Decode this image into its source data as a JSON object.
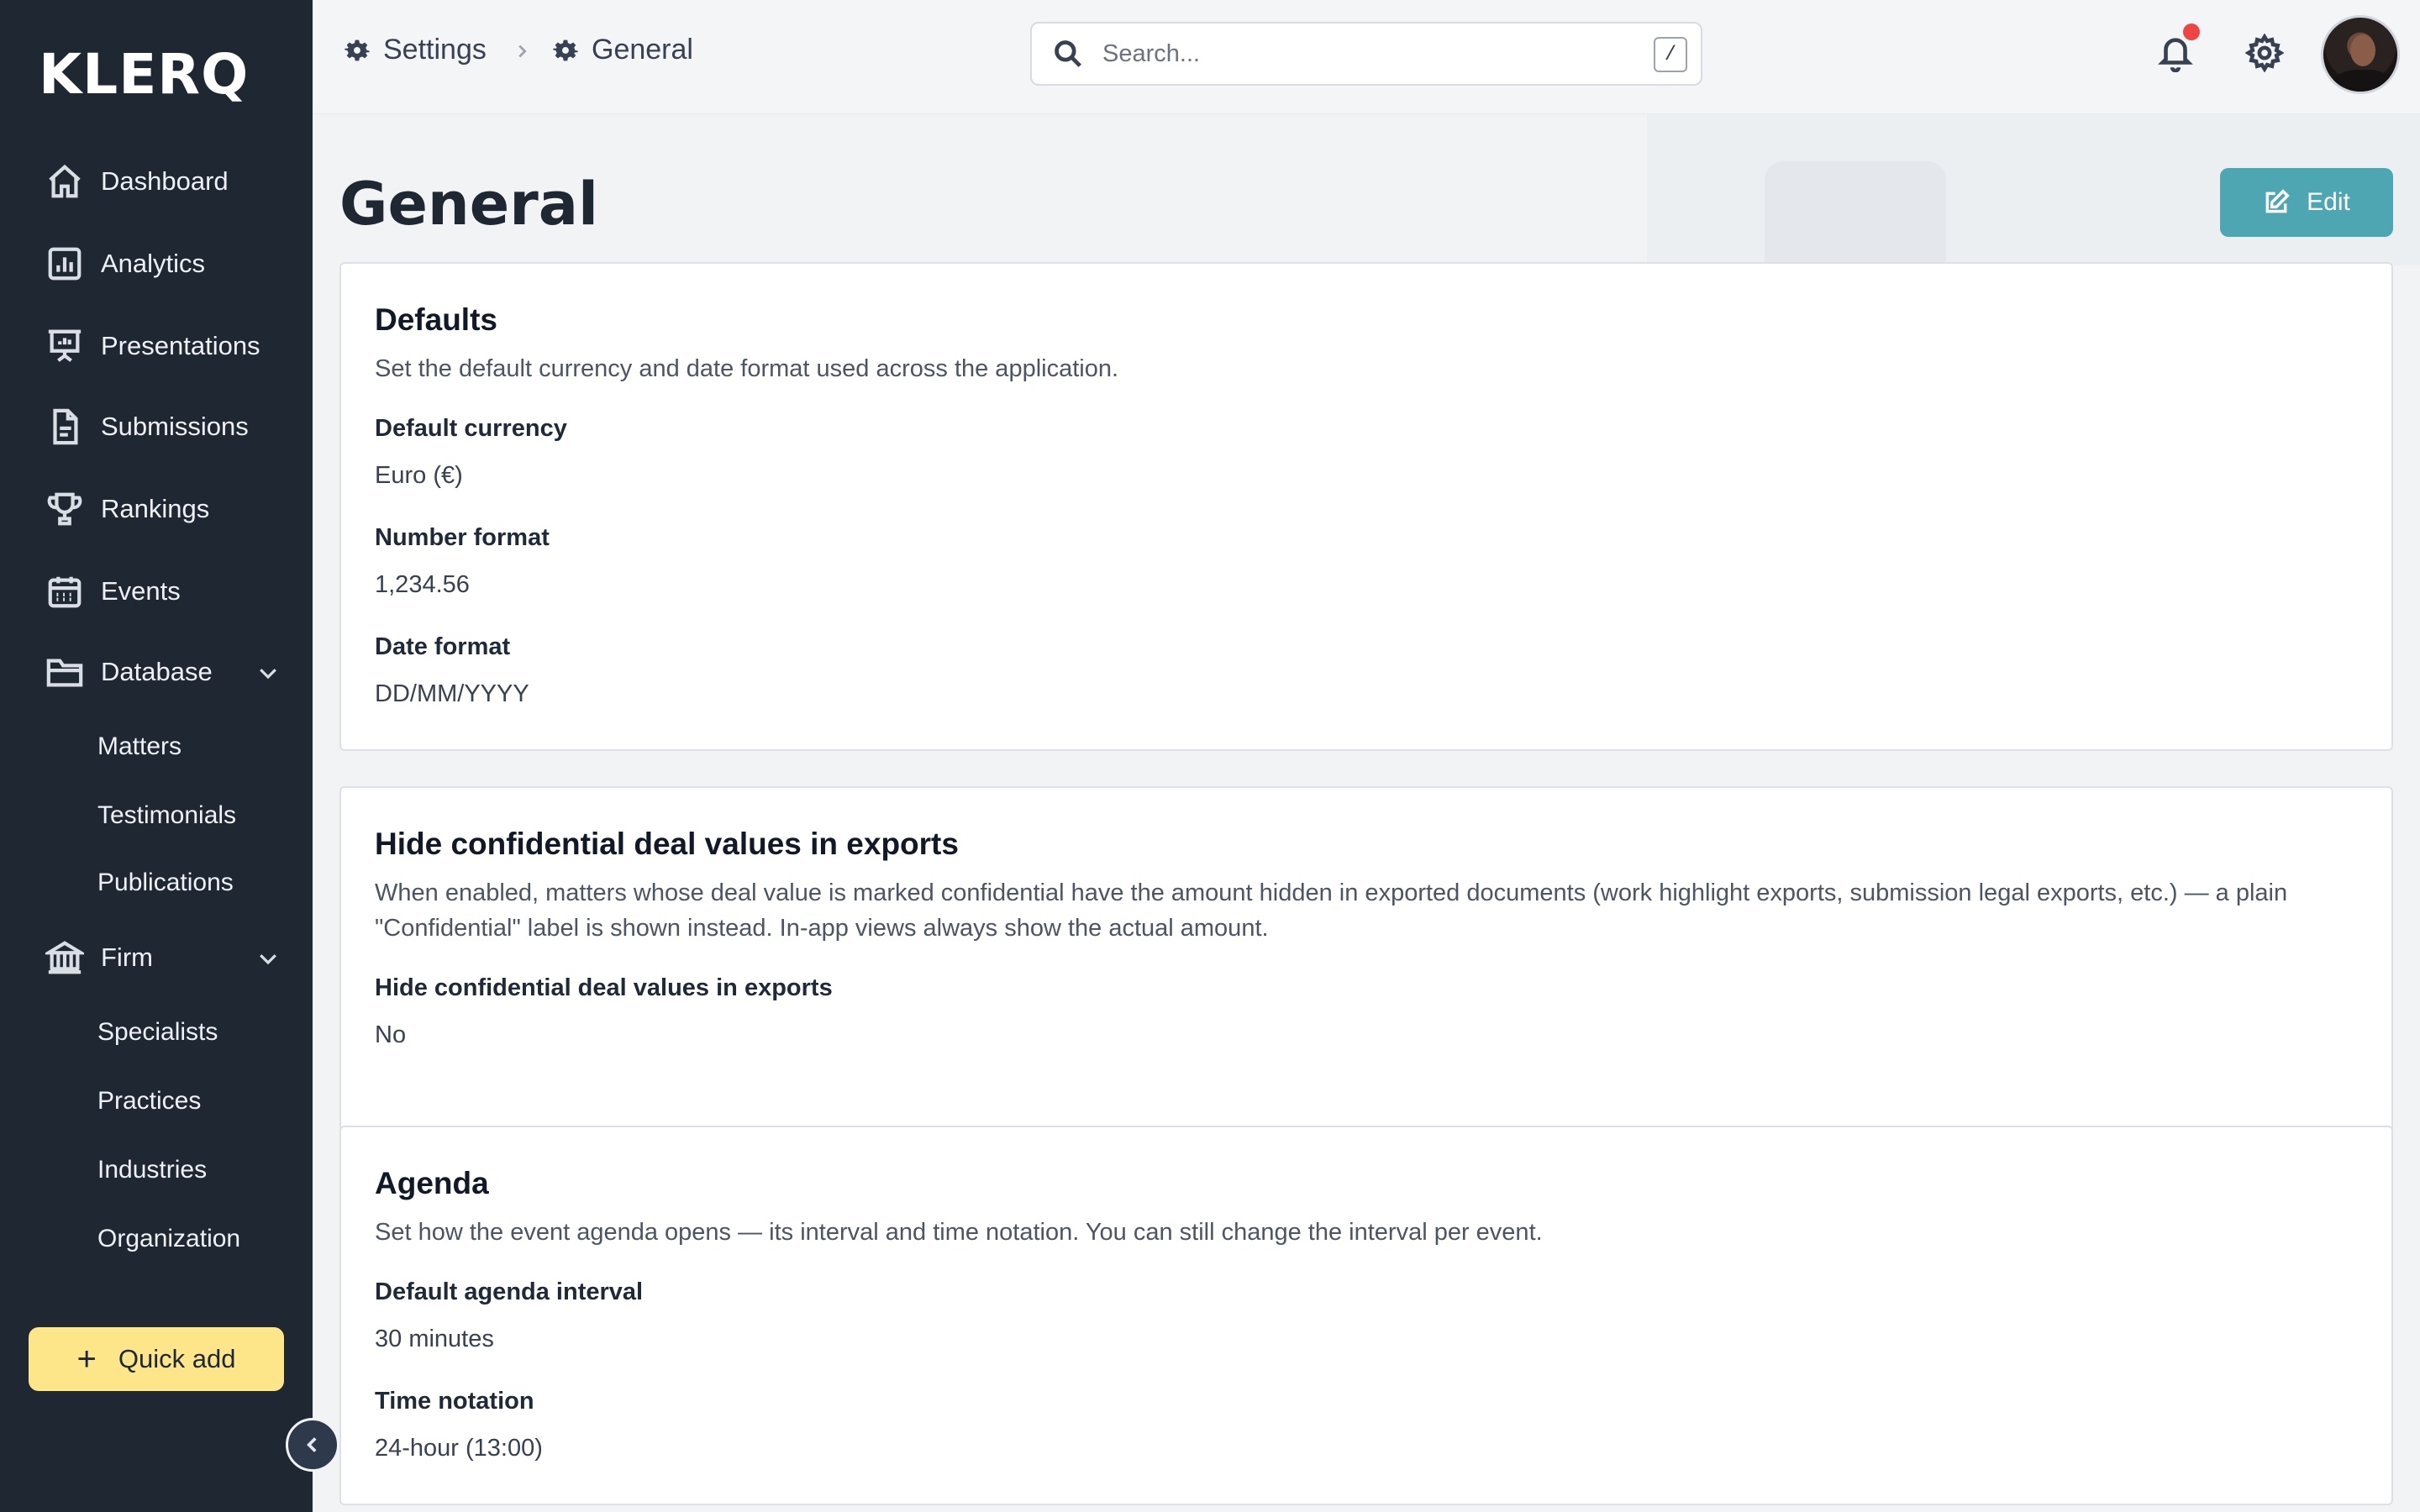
{
  "app": {
    "logo": "KLERQ"
  },
  "sidebar": {
    "items": [
      {
        "label": "Dashboard",
        "icon": "home-icon"
      },
      {
        "label": "Analytics",
        "icon": "analytics-icon"
      },
      {
        "label": "Presentations",
        "icon": "presentation-icon"
      },
      {
        "label": "Submissions",
        "icon": "document-icon"
      },
      {
        "label": "Rankings",
        "icon": "trophy-icon"
      },
      {
        "label": "Events",
        "icon": "calendar-icon"
      },
      {
        "label": "Database",
        "icon": "folder-icon",
        "expanded": true,
        "children": [
          "Matters",
          "Testimonials",
          "Publications"
        ]
      },
      {
        "label": "Firm",
        "icon": "bank-icon",
        "expanded": true,
        "children": [
          "Specialists",
          "Practices",
          "Industries",
          "Organization"
        ]
      }
    ],
    "quick_add_label": "Quick add"
  },
  "header": {
    "breadcrumb": [
      "Settings",
      "General"
    ],
    "search": {
      "placeholder": "Search...",
      "shortcut": "/"
    },
    "notifications": {
      "unread": true
    }
  },
  "page": {
    "title": "General",
    "edit_label": "Edit",
    "accent_color": "#4ea6b3"
  },
  "sections": [
    {
      "title": "Defaults",
      "description": "Set the default currency and date format used across the application.",
      "fields": [
        {
          "label": "Default currency",
          "value": "Euro (€)"
        },
        {
          "label": "Number format",
          "value": "1,234.56"
        },
        {
          "label": "Date format",
          "value": "DD/MM/YYYY"
        }
      ]
    },
    {
      "title": "Hide confidential deal values in exports",
      "description": "When enabled, matters whose deal value is marked confidential have the amount hidden in exported documents (work highlight exports, submission legal exports, etc.) — a plain \"Confidential\" label is shown instead. In-app views always show the actual amount.",
      "fields": [
        {
          "label": "Hide confidential deal values in exports",
          "value": "No"
        }
      ]
    },
    {
      "title": "Agenda",
      "description": "Set how the event agenda opens — its interval and time notation. You can still change the interval per event.",
      "fields": [
        {
          "label": "Default agenda interval",
          "value": "30 minutes"
        },
        {
          "label": "Time notation",
          "value": "24-hour (13:00)"
        }
      ]
    }
  ]
}
